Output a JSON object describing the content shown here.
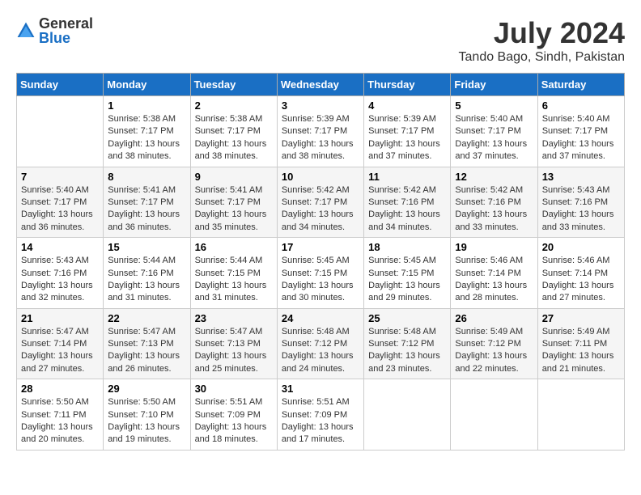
{
  "logo": {
    "general": "General",
    "blue": "Blue"
  },
  "header": {
    "month_year": "July 2024",
    "location": "Tando Bago, Sindh, Pakistan"
  },
  "weekdays": [
    "Sunday",
    "Monday",
    "Tuesday",
    "Wednesday",
    "Thursday",
    "Friday",
    "Saturday"
  ],
  "weeks": [
    [
      {
        "day": "",
        "sunrise": "",
        "sunset": "",
        "daylight": ""
      },
      {
        "day": "1",
        "sunrise": "Sunrise: 5:38 AM",
        "sunset": "Sunset: 7:17 PM",
        "daylight": "Daylight: 13 hours and 38 minutes."
      },
      {
        "day": "2",
        "sunrise": "Sunrise: 5:38 AM",
        "sunset": "Sunset: 7:17 PM",
        "daylight": "Daylight: 13 hours and 38 minutes."
      },
      {
        "day": "3",
        "sunrise": "Sunrise: 5:39 AM",
        "sunset": "Sunset: 7:17 PM",
        "daylight": "Daylight: 13 hours and 38 minutes."
      },
      {
        "day": "4",
        "sunrise": "Sunrise: 5:39 AM",
        "sunset": "Sunset: 7:17 PM",
        "daylight": "Daylight: 13 hours and 37 minutes."
      },
      {
        "day": "5",
        "sunrise": "Sunrise: 5:40 AM",
        "sunset": "Sunset: 7:17 PM",
        "daylight": "Daylight: 13 hours and 37 minutes."
      },
      {
        "day": "6",
        "sunrise": "Sunrise: 5:40 AM",
        "sunset": "Sunset: 7:17 PM",
        "daylight": "Daylight: 13 hours and 37 minutes."
      }
    ],
    [
      {
        "day": "7",
        "sunrise": "Sunrise: 5:40 AM",
        "sunset": "Sunset: 7:17 PM",
        "daylight": "Daylight: 13 hours and 36 minutes."
      },
      {
        "day": "8",
        "sunrise": "Sunrise: 5:41 AM",
        "sunset": "Sunset: 7:17 PM",
        "daylight": "Daylight: 13 hours and 36 minutes."
      },
      {
        "day": "9",
        "sunrise": "Sunrise: 5:41 AM",
        "sunset": "Sunset: 7:17 PM",
        "daylight": "Daylight: 13 hours and 35 minutes."
      },
      {
        "day": "10",
        "sunrise": "Sunrise: 5:42 AM",
        "sunset": "Sunset: 7:17 PM",
        "daylight": "Daylight: 13 hours and 34 minutes."
      },
      {
        "day": "11",
        "sunrise": "Sunrise: 5:42 AM",
        "sunset": "Sunset: 7:16 PM",
        "daylight": "Daylight: 13 hours and 34 minutes."
      },
      {
        "day": "12",
        "sunrise": "Sunrise: 5:42 AM",
        "sunset": "Sunset: 7:16 PM",
        "daylight": "Daylight: 13 hours and 33 minutes."
      },
      {
        "day": "13",
        "sunrise": "Sunrise: 5:43 AM",
        "sunset": "Sunset: 7:16 PM",
        "daylight": "Daylight: 13 hours and 33 minutes."
      }
    ],
    [
      {
        "day": "14",
        "sunrise": "Sunrise: 5:43 AM",
        "sunset": "Sunset: 7:16 PM",
        "daylight": "Daylight: 13 hours and 32 minutes."
      },
      {
        "day": "15",
        "sunrise": "Sunrise: 5:44 AM",
        "sunset": "Sunset: 7:16 PM",
        "daylight": "Daylight: 13 hours and 31 minutes."
      },
      {
        "day": "16",
        "sunrise": "Sunrise: 5:44 AM",
        "sunset": "Sunset: 7:15 PM",
        "daylight": "Daylight: 13 hours and 31 minutes."
      },
      {
        "day": "17",
        "sunrise": "Sunrise: 5:45 AM",
        "sunset": "Sunset: 7:15 PM",
        "daylight": "Daylight: 13 hours and 30 minutes."
      },
      {
        "day": "18",
        "sunrise": "Sunrise: 5:45 AM",
        "sunset": "Sunset: 7:15 PM",
        "daylight": "Daylight: 13 hours and 29 minutes."
      },
      {
        "day": "19",
        "sunrise": "Sunrise: 5:46 AM",
        "sunset": "Sunset: 7:14 PM",
        "daylight": "Daylight: 13 hours and 28 minutes."
      },
      {
        "day": "20",
        "sunrise": "Sunrise: 5:46 AM",
        "sunset": "Sunset: 7:14 PM",
        "daylight": "Daylight: 13 hours and 27 minutes."
      }
    ],
    [
      {
        "day": "21",
        "sunrise": "Sunrise: 5:47 AM",
        "sunset": "Sunset: 7:14 PM",
        "daylight": "Daylight: 13 hours and 27 minutes."
      },
      {
        "day": "22",
        "sunrise": "Sunrise: 5:47 AM",
        "sunset": "Sunset: 7:13 PM",
        "daylight": "Daylight: 13 hours and 26 minutes."
      },
      {
        "day": "23",
        "sunrise": "Sunrise: 5:47 AM",
        "sunset": "Sunset: 7:13 PM",
        "daylight": "Daylight: 13 hours and 25 minutes."
      },
      {
        "day": "24",
        "sunrise": "Sunrise: 5:48 AM",
        "sunset": "Sunset: 7:12 PM",
        "daylight": "Daylight: 13 hours and 24 minutes."
      },
      {
        "day": "25",
        "sunrise": "Sunrise: 5:48 AM",
        "sunset": "Sunset: 7:12 PM",
        "daylight": "Daylight: 13 hours and 23 minutes."
      },
      {
        "day": "26",
        "sunrise": "Sunrise: 5:49 AM",
        "sunset": "Sunset: 7:12 PM",
        "daylight": "Daylight: 13 hours and 22 minutes."
      },
      {
        "day": "27",
        "sunrise": "Sunrise: 5:49 AM",
        "sunset": "Sunset: 7:11 PM",
        "daylight": "Daylight: 13 hours and 21 minutes."
      }
    ],
    [
      {
        "day": "28",
        "sunrise": "Sunrise: 5:50 AM",
        "sunset": "Sunset: 7:11 PM",
        "daylight": "Daylight: 13 hours and 20 minutes."
      },
      {
        "day": "29",
        "sunrise": "Sunrise: 5:50 AM",
        "sunset": "Sunset: 7:10 PM",
        "daylight": "Daylight: 13 hours and 19 minutes."
      },
      {
        "day": "30",
        "sunrise": "Sunrise: 5:51 AM",
        "sunset": "Sunset: 7:09 PM",
        "daylight": "Daylight: 13 hours and 18 minutes."
      },
      {
        "day": "31",
        "sunrise": "Sunrise: 5:51 AM",
        "sunset": "Sunset: 7:09 PM",
        "daylight": "Daylight: 13 hours and 17 minutes."
      },
      {
        "day": "",
        "sunrise": "",
        "sunset": "",
        "daylight": ""
      },
      {
        "day": "",
        "sunrise": "",
        "sunset": "",
        "daylight": ""
      },
      {
        "day": "",
        "sunrise": "",
        "sunset": "",
        "daylight": ""
      }
    ]
  ]
}
